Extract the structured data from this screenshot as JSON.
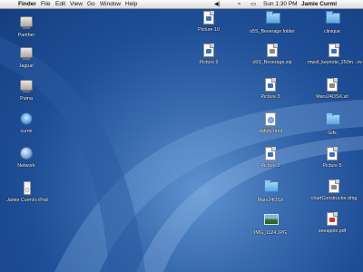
{
  "menubar": {
    "app": "Finder",
    "menus": [
      "File",
      "Edit",
      "View",
      "Go",
      "Window",
      "Help"
    ],
    "clock": "Sun 1:30 PM",
    "user": "Jamie Curmi"
  },
  "desktop_left": [
    {
      "label": "Panther",
      "icon": "drive-icon"
    },
    {
      "label": "Jaguar",
      "icon": "drive-icon"
    },
    {
      "label": "Puma",
      "icon": "drive-icon"
    },
    {
      "label": "curmi",
      "icon": "user-home-icon"
    },
    {
      "label": "Network",
      "icon": "network-globe-icon"
    },
    {
      "label": "Jamie Curmi's iPod",
      "icon": "ipod-icon"
    }
  ],
  "desktop_right": [
    {
      "label": "Picture 10",
      "icon": "document-icon"
    },
    {
      "label": "Picture 9",
      "icon": "document-icon"
    },
    {
      "label": "o5S_Beverage folder",
      "icon": "folder-icon"
    },
    {
      "label": "o5S_Beverage.zip",
      "icon": "zip-document-icon"
    },
    {
      "label": "Picture 3",
      "icon": "document-icon"
    },
    {
      "label": "dgfgfg.html",
      "icon": "html-document-icon"
    },
    {
      "label": "Picture 2",
      "icon": "document-icon"
    },
    {
      "label": "Mars24OSX",
      "icon": "folder-icon"
    },
    {
      "label": "IMG_1124.JPG",
      "icon": "photo-icon"
    },
    {
      "label": "clinique",
      "icon": "folder-icon"
    },
    {
      "label": "mwsf_keynote_250m...ov",
      "icon": "document-icon"
    },
    {
      "label": "Mars24OSX.sit",
      "icon": "zip-document-icon"
    },
    {
      "label": "Gifs",
      "icon": "folder-icon"
    },
    {
      "label": "Picture 5",
      "icon": "document-icon"
    },
    {
      "label": "chartConstructor.dmg",
      "icon": "document-icon"
    },
    {
      "label": "seeapple.pdf",
      "icon": "pdf-document-icon"
    }
  ]
}
